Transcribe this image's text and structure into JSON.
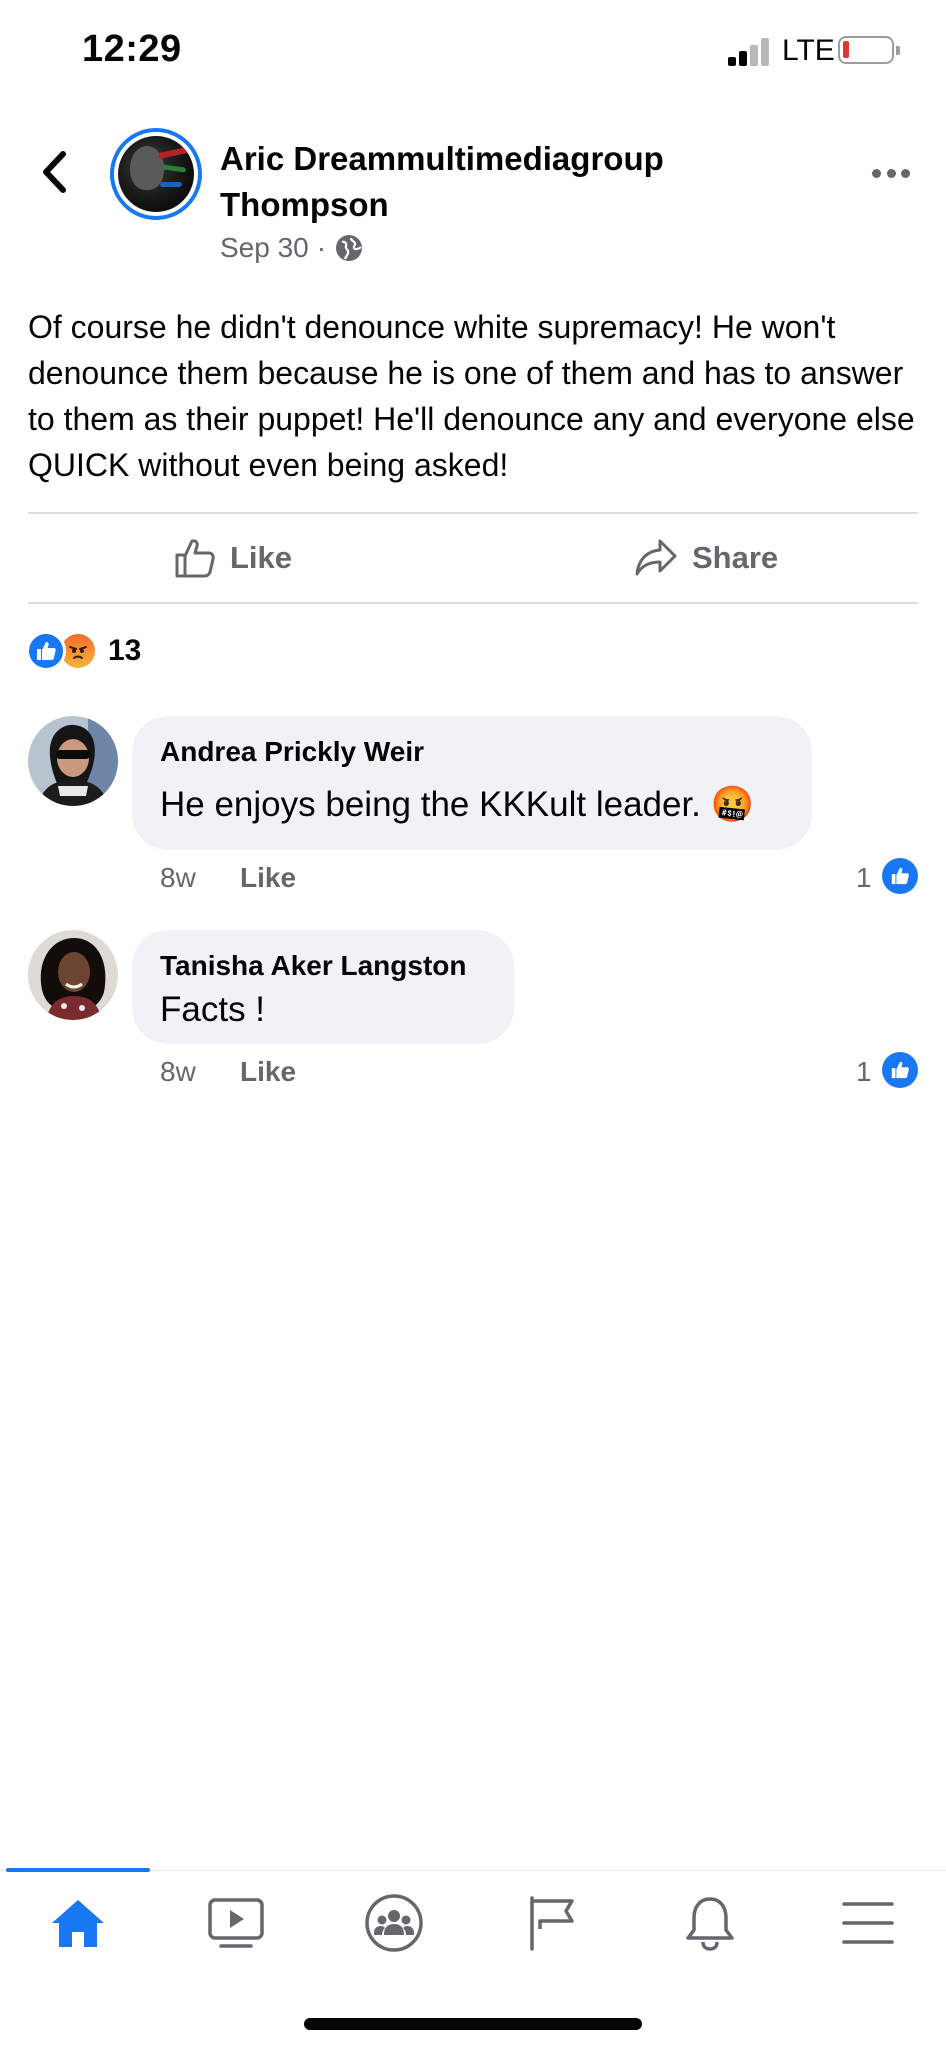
{
  "status_bar": {
    "time": "12:29",
    "network": "LTE"
  },
  "post": {
    "author": "Aric Dreammultimediagroup Thompson",
    "date": "Sep 30",
    "meta_separator": "·",
    "privacy_icon": "globe-icon",
    "text": "Of course he didn't denounce white supremacy! He won't denounce them because he is one of them and has to answer to them as their puppet! He'll denounce any and everyone else QUICK without even being asked!",
    "actions": {
      "like_label": "Like",
      "share_label": "Share"
    },
    "reactions": {
      "types": [
        "like",
        "angry"
      ],
      "count": "13"
    }
  },
  "comments": [
    {
      "author": "Andrea Prickly Weir",
      "text": "He enjoys being the KKKult leader. 🤬",
      "time": "8w",
      "like_label": "Like",
      "like_count": "1"
    },
    {
      "author": "Tanisha Aker Langston",
      "text": "Facts !",
      "time": "8w",
      "like_label": "Like",
      "like_count": "1"
    }
  ],
  "tab_bar": {
    "active": "home",
    "tabs": [
      "home-icon",
      "watch-icon",
      "groups-icon",
      "pages-flag-icon",
      "notifications-bell-icon",
      "menu-icon"
    ]
  },
  "colors": {
    "accent": "#1877f2",
    "secondary_text": "#65676b",
    "bubble": "#f0f2f5",
    "divider": "#dadde1"
  }
}
